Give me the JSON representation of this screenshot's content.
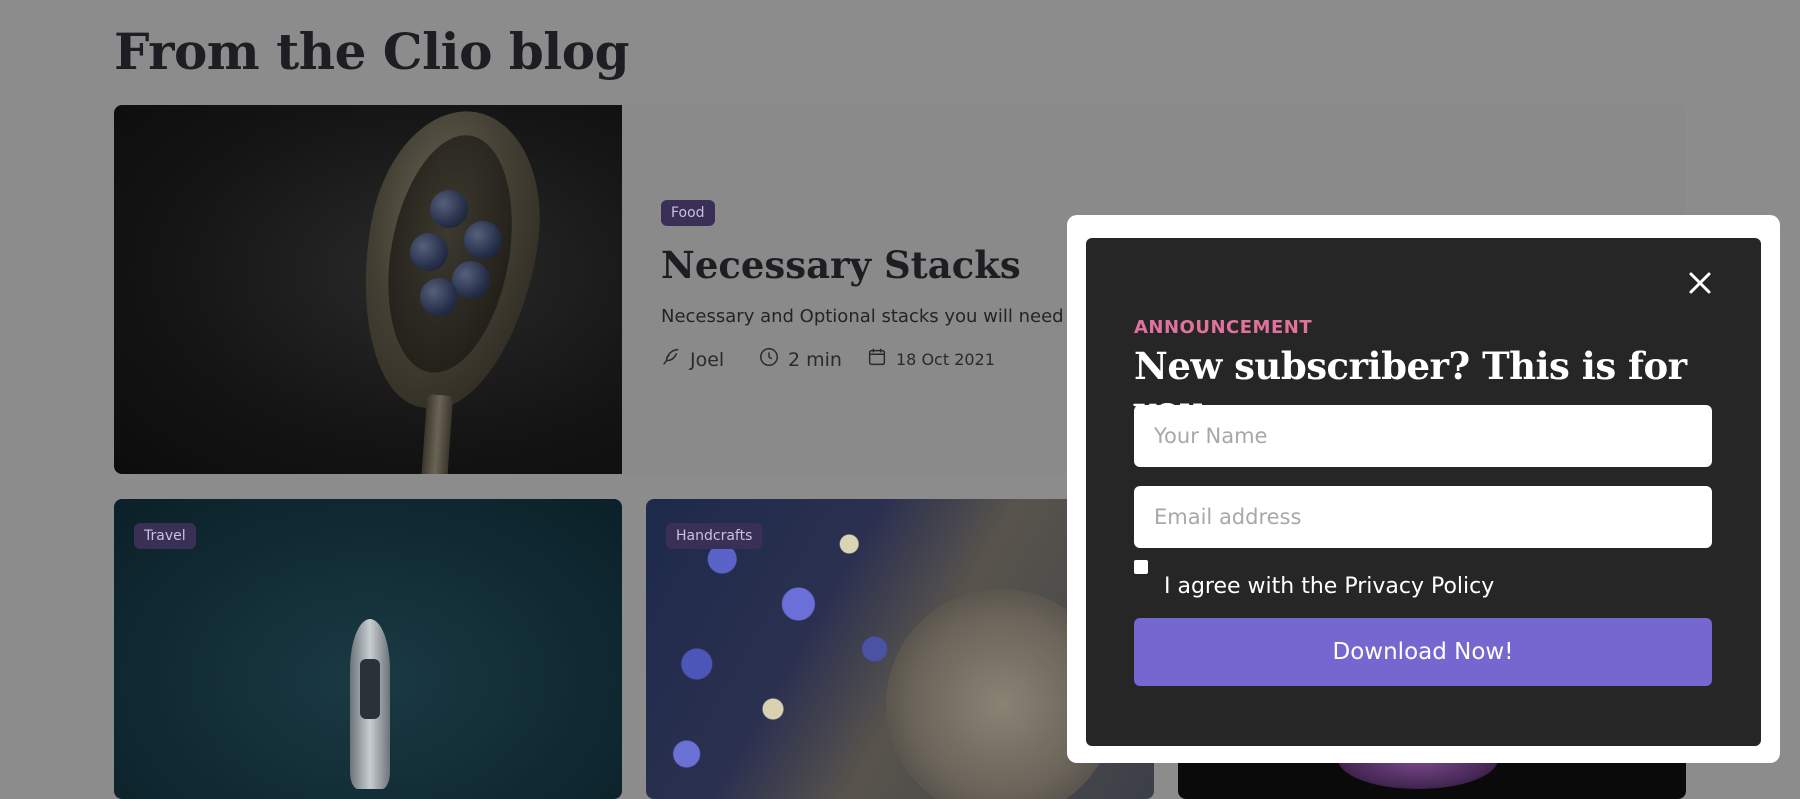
{
  "blog": {
    "title": "From the Clio blog",
    "featured": {
      "tag": "Food",
      "title": "Necessary Stacks",
      "excerpt": "Necessary and Optional stacks you will need to run Clio project.",
      "author": "Joel",
      "read_time": "2 min",
      "date": "18 Oct 2021"
    },
    "cards": [
      {
        "tag": "Travel"
      },
      {
        "tag": "Handcrafts"
      },
      {
        "tag": ""
      }
    ]
  },
  "popup": {
    "eyebrow": "ANNOUNCEMENT",
    "title": "New subscriber? This is for you",
    "name_placeholder": "Your Name",
    "email_placeholder": "Email address",
    "agree_label": "I agree with the Privacy Policy",
    "submit_label": "Download Now!"
  },
  "colors": {
    "overlay": "#8c8c8c",
    "tag_bg": "#3a2f55",
    "eyebrow": "#e2729b",
    "submit_bg": "#7567d0",
    "modal_bg": "#262626"
  }
}
